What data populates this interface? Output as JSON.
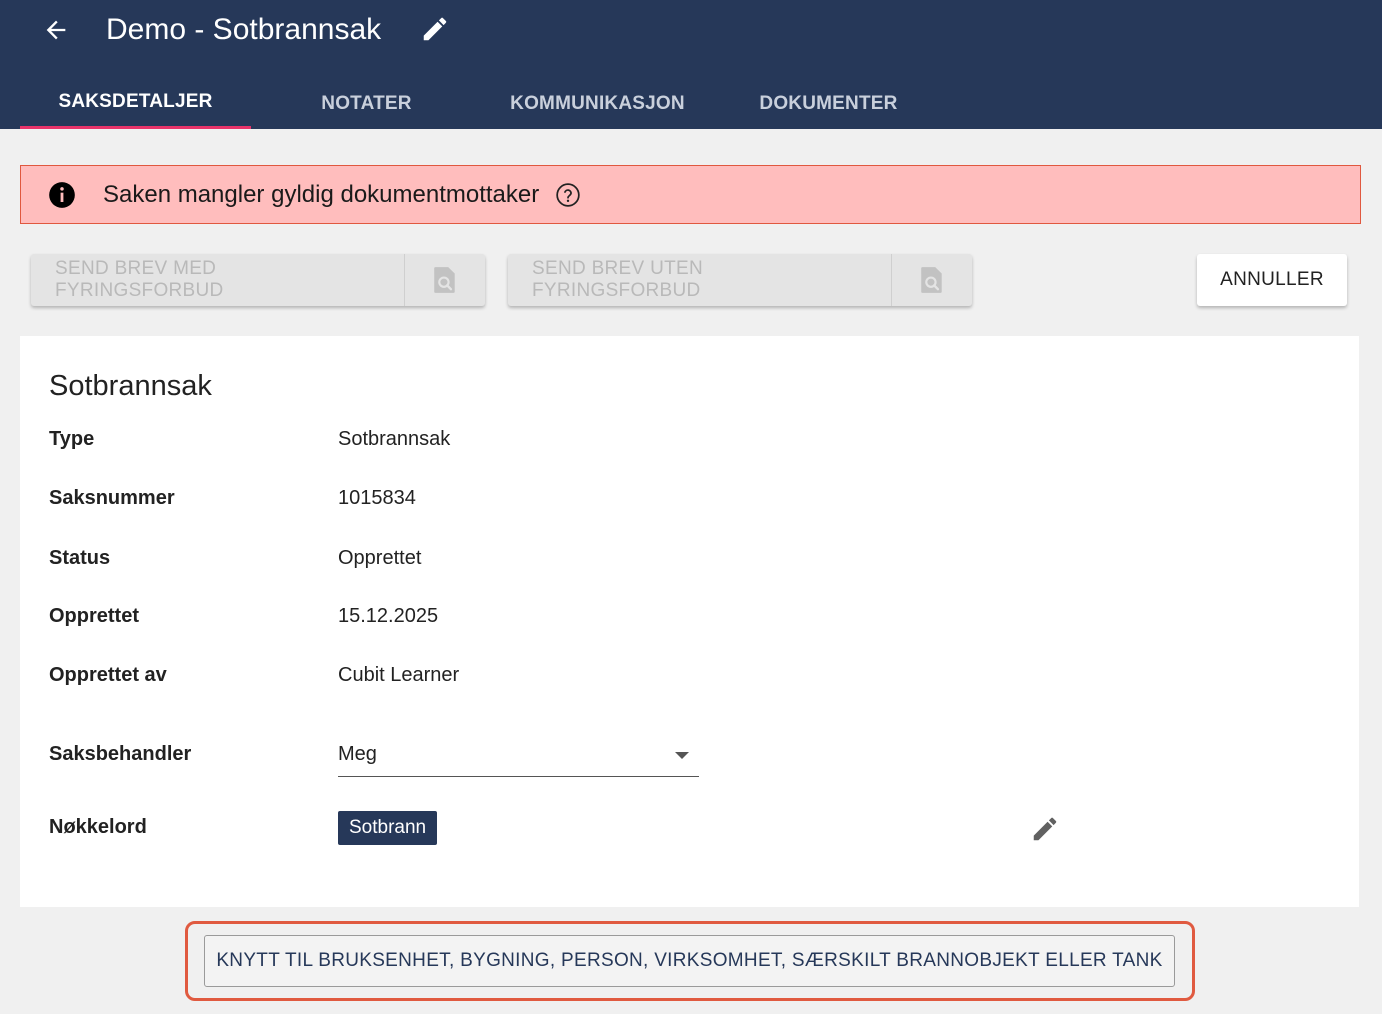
{
  "header": {
    "title": "Demo - Sotbrannsak",
    "back_icon": "arrow-left-icon",
    "edit_icon": "pencil-icon",
    "background": "#263859"
  },
  "tabs": [
    {
      "label": "SAKSDETALJER",
      "active": true
    },
    {
      "label": "NOTATER",
      "active": false
    },
    {
      "label": "KOMMUNIKASJON",
      "active": false
    },
    {
      "label": "DOKUMENTER",
      "active": false
    }
  ],
  "alert": {
    "text": "Saken mangler gyldig dokumentmottaker",
    "icon": "info-icon",
    "help_icon": "help-circle-icon",
    "color": "#ffbdbd"
  },
  "actions": {
    "send_with": "SEND BREV MED FYRINGSFORBUD",
    "send_without": "SEND BREV UTEN FYRINGSFORBUD",
    "preview_icon": "document-search-icon",
    "cancel": "ANNULLER"
  },
  "details": {
    "title": "Sotbrannsak",
    "rows": [
      {
        "label": "Type",
        "value": "Sotbrannsak"
      },
      {
        "label": "Saksnummer",
        "value": "1015834"
      },
      {
        "label": "Status",
        "value": "Opprettet"
      },
      {
        "label": "Opprettet",
        "value": "15.12.2025"
      },
      {
        "label": "Opprettet av",
        "value": "Cubit Learner"
      }
    ],
    "handler_label": "Saksbehandler",
    "handler_value": "Meg",
    "keywords_label": "Nøkkelord",
    "keywords": [
      "Sotbrann"
    ],
    "accent": "#263859"
  },
  "link_button": "KNYTT TIL BRUKSENHET, BYGNING, PERSON, VIRKSOMHET, SÆRSKILT BRANNOBJEKT ELLER TANK"
}
